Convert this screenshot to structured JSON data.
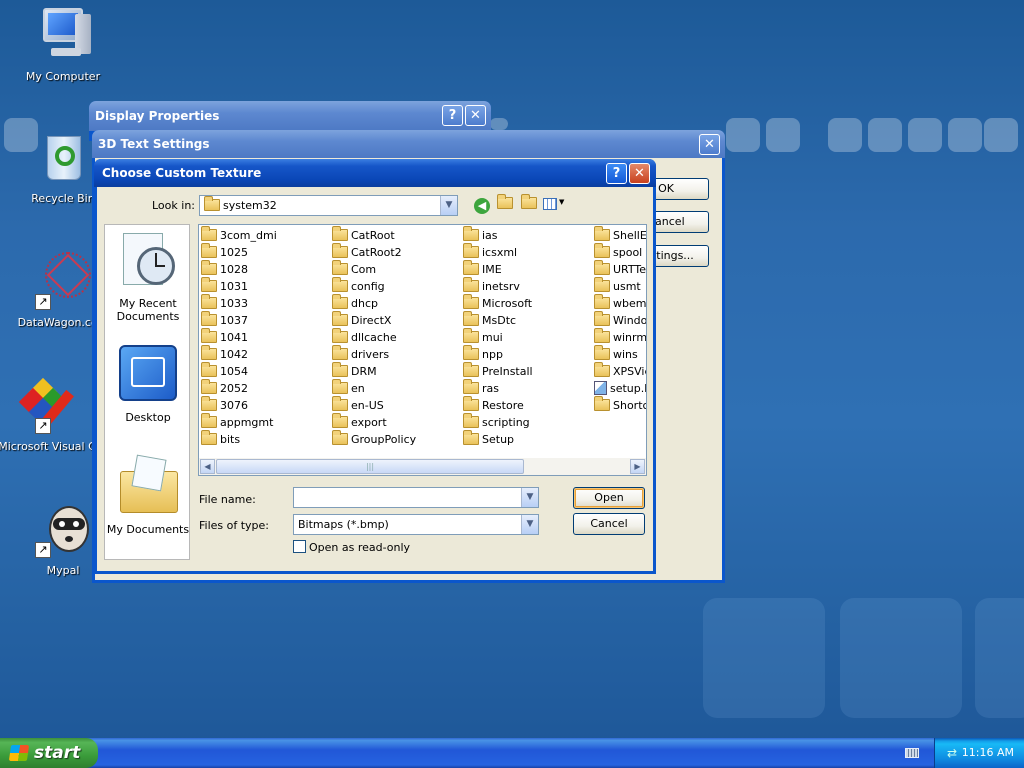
{
  "desktop": {
    "icons": [
      {
        "label": "My Computer",
        "icon": "computer-icon"
      },
      {
        "label": "Recycle Bin",
        "icon": "recycle-bin-icon"
      },
      {
        "label": "DataWagon.com",
        "icon": "datawagon-icon"
      },
      {
        "label": "Microsoft Visual C",
        "icon": "visual-studio-icon"
      },
      {
        "label": "Mypal",
        "icon": "mypal-icon"
      }
    ]
  },
  "display_properties": {
    "title": "Display Properties",
    "help": "?",
    "close": "✕"
  },
  "text3d": {
    "title": "3D Text Settings",
    "close": "✕",
    "ok": "OK",
    "cancel": "Cancel",
    "settings": "Settings..."
  },
  "dialog": {
    "title": "Choose Custom Texture",
    "help": "?",
    "close": "✕",
    "look_in_label": "Look in:",
    "look_in_value": "system32",
    "places": [
      {
        "label": "My Recent Documents"
      },
      {
        "label": "Desktop"
      },
      {
        "label": "My Documents"
      }
    ],
    "files": [
      [
        "3com_dmi",
        "1025",
        "1028",
        "1031",
        "1033",
        "1037",
        "1041",
        "1042",
        "1054",
        "2052",
        "3076",
        "appmgmt",
        "bits"
      ],
      [
        "CatRoot",
        "CatRoot2",
        "Com",
        "config",
        "dhcp",
        "DirectX",
        "dllcache",
        "drivers",
        "DRM",
        "en",
        "en-US",
        "export",
        "GroupPolicy"
      ],
      [
        "ias",
        "icsxml",
        "IME",
        "inetsrv",
        "Microsoft",
        "MsDtc",
        "mui",
        "npp",
        "PreInstall",
        "ras",
        "Restore",
        "scripting",
        "Setup"
      ],
      [
        "ShellExt",
        "spool",
        "URTTemp",
        "usmt",
        "wbem",
        "Windows",
        "winrm",
        "wins",
        "XPSViewer",
        "setup.bmp",
        "Shortcut"
      ]
    ],
    "file_name_label": "File name:",
    "file_name_value": "",
    "files_of_type_label": "Files of type:",
    "files_of_type_value": "Bitmaps (*.bmp)",
    "readonly_label": "Open as read-only",
    "open": "Open",
    "cancel": "Cancel"
  },
  "taskbar": {
    "start": "start",
    "clock": "11:16 AM"
  }
}
